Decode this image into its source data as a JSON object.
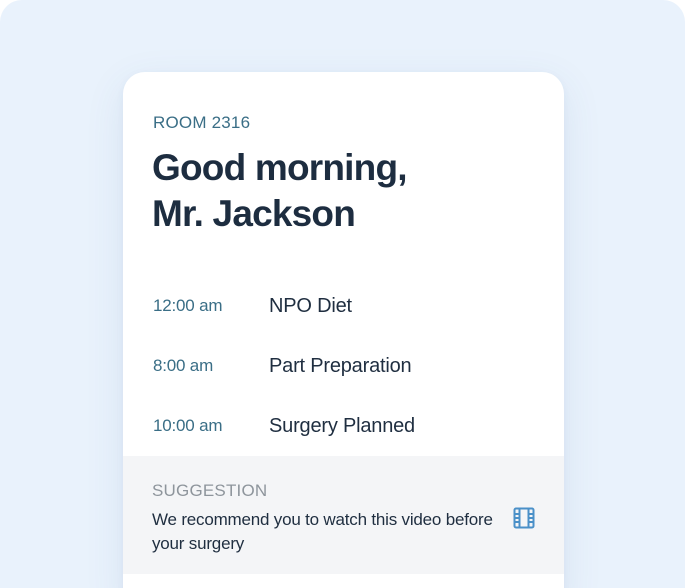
{
  "patient_card": {
    "room_label": "ROOM 2316",
    "greeting_line1": "Good morning,",
    "greeting_line2": "Mr. Jackson",
    "schedule": [
      {
        "time": "12:00 am",
        "event": "NPO Diet"
      },
      {
        "time": "8:00 am",
        "event": "Part Preparation"
      },
      {
        "time": "10:00 am",
        "event": "Surgery Planned"
      }
    ],
    "suggestion": {
      "label": "SUGGESTION",
      "text": "We recommend you to watch this video before your surgery",
      "icon": "film-icon"
    }
  },
  "colors": {
    "page_background": "#e9f2fc",
    "card_background": "#ffffff",
    "accent_teal": "#3a6e86",
    "heading": "#1d2d40",
    "suggestion_background": "#f4f5f7",
    "suggestion_label": "#8e959c",
    "icon_blue": "#4a90c8"
  }
}
